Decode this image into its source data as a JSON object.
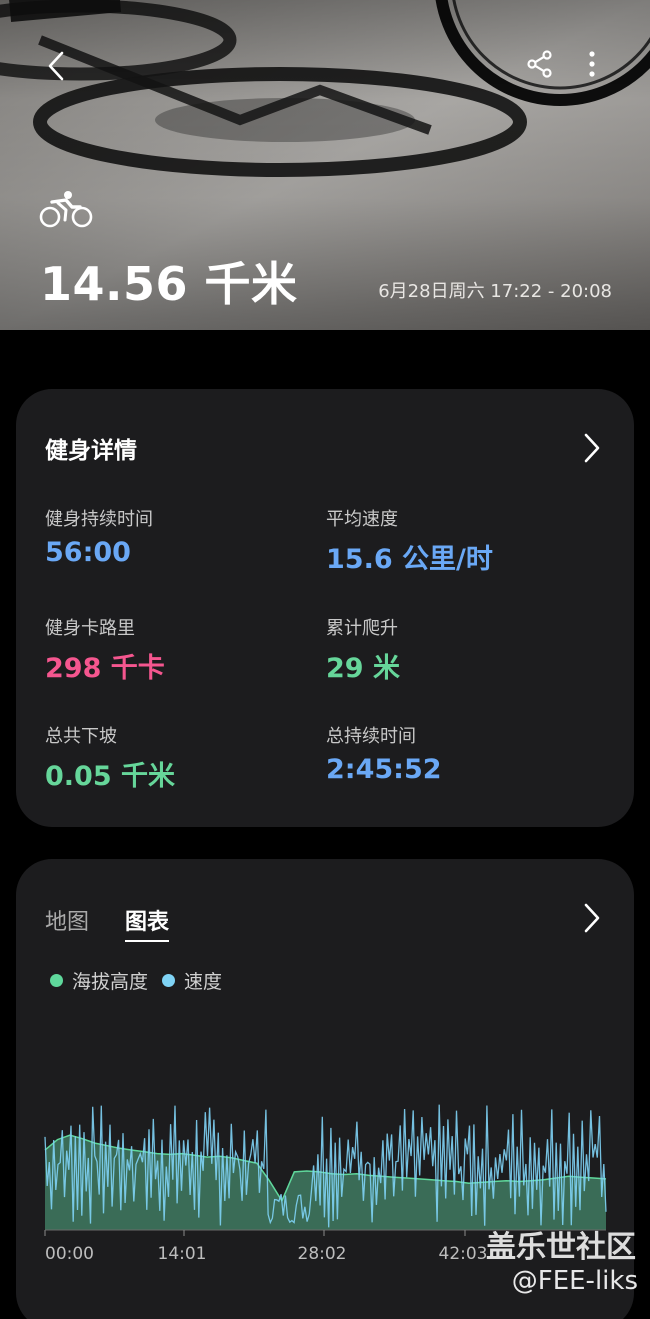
{
  "header": {
    "distance": "14.56 千米",
    "datetime": "6月28日周六 17:22 - 20:08",
    "icons": [
      "back-icon",
      "share-icon",
      "more-vert-icon",
      "cycling-icon"
    ]
  },
  "details": {
    "title": "健身详情",
    "metrics": [
      {
        "label": "健身持续时间",
        "value": "56:00",
        "color": "#6aa8f5"
      },
      {
        "label": "平均速度",
        "value": "15.6 公里/时",
        "color": "#6aa8f5"
      },
      {
        "label": "健身卡路里",
        "value": "298 千卡",
        "color": "#f5568f"
      },
      {
        "label": "累计爬升",
        "value": "29 米",
        "color": "#66d69a"
      },
      {
        "label": "总共下坡",
        "value": "0.05 千米",
        "color": "#66d69a"
      },
      {
        "label": "总持续时间",
        "value": "2:45:52",
        "color": "#6aa8f5"
      }
    ]
  },
  "chart_section": {
    "tabs": [
      "地图",
      "图表"
    ],
    "active_tab": "图表"
  },
  "chart_data": {
    "type": "area",
    "legend_position": "top-left",
    "series": [
      {
        "name": "海拔高度",
        "color": "#5fd89c",
        "values": [
          0.8,
          0.92,
          0.97,
          0.93,
          0.88,
          0.85,
          0.82,
          0.8,
          0.78,
          0.76,
          0.75,
          0.76,
          0.74,
          0.72,
          0.73,
          0.71,
          0.68,
          0.65,
          0.45,
          0.22,
          0.55,
          0.56,
          0.55,
          0.53,
          0.52,
          0.53,
          0.51,
          0.5,
          0.49,
          0.48,
          0.47,
          0.46,
          0.45,
          0.44,
          0.42,
          0.43,
          0.44,
          0.45,
          0.44,
          0.45,
          0.46,
          0.48,
          0.5,
          0.49,
          0.48,
          0.47
        ]
      },
      {
        "name": "速度",
        "color": "#7fd3f5"
      }
    ],
    "x_ticks": [
      "00:00",
      "14:01",
      "28:02",
      "42:03"
    ]
  },
  "watermark": {
    "line1": "盖乐世社区",
    "line2": "@FEE-liks"
  }
}
